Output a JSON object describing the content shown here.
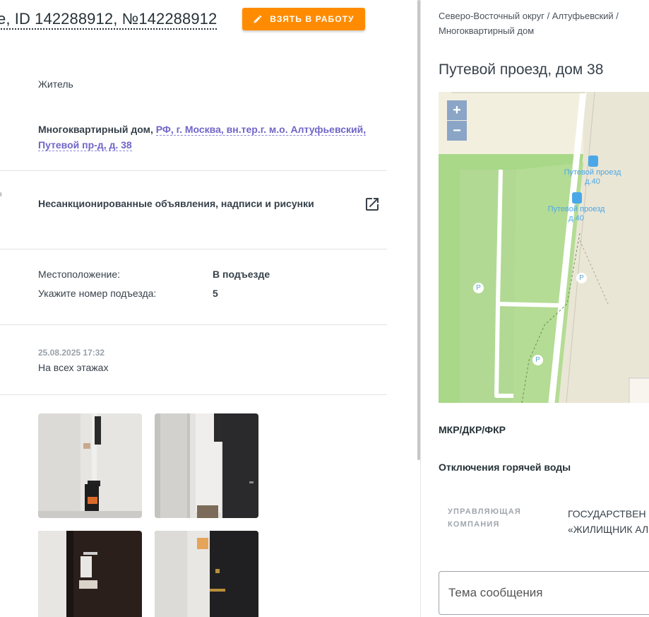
{
  "header": {
    "ticket_title": "e, ID 142288912, №142288912",
    "take_button_label": "ВЗЯТЬ В РАБОТУ"
  },
  "details": {
    "applicant_type": "Житель",
    "object_type": "Многоквартирный дом,",
    "object_address": "РФ, г. Москва, вн.тер.г. м.о. Алтуфьевский, Путевой пр-д, д. 38",
    "cut_label": "я",
    "category": "Несанкционированные объявления, надписи и рисунки",
    "location_label": "Местоположение:",
    "location_value": "В подъезде",
    "entrance_label": "Укажите номер подъезда:",
    "entrance_value": "5",
    "comment_date": "25.08.2025 17:32",
    "comment_text": "На всех этажах"
  },
  "photos": [
    "photo-1",
    "photo-2",
    "photo-3",
    "photo-4"
  ],
  "right_panel": {
    "breadcrumb": "Северо-Восточный округ / Алтуфьевский / Многоквартирный дом",
    "address_title": "Путевой проезд, дом 38",
    "map": {
      "zoom_in": "+",
      "zoom_out": "−",
      "bus_stop_1_line1": "Путевой проезд",
      "bus_stop_1_line2": "д.40",
      "bus_stop_2_line1": "Путевой проезд",
      "bus_stop_2_line2": "д.40",
      "parking_label": "P"
    },
    "mkr_label": "МКР/ДКР/ФКР",
    "hot_water_label": "Отключения горячей воды",
    "mgmt_label": "УПРАВЛЯЮЩАЯ КОМПАНИЯ",
    "mgmt_value_line1": "ГОСУДАРСТВЕН",
    "mgmt_value_line2": "«ЖИЛИЩНИК АЛ",
    "message_placeholder": "Тема сообщения"
  },
  "colors": {
    "accent_orange": "#ff8c00",
    "link_purple": "#6f65c9",
    "map_green": "#a8d888",
    "map_beige": "#eae6d6"
  }
}
